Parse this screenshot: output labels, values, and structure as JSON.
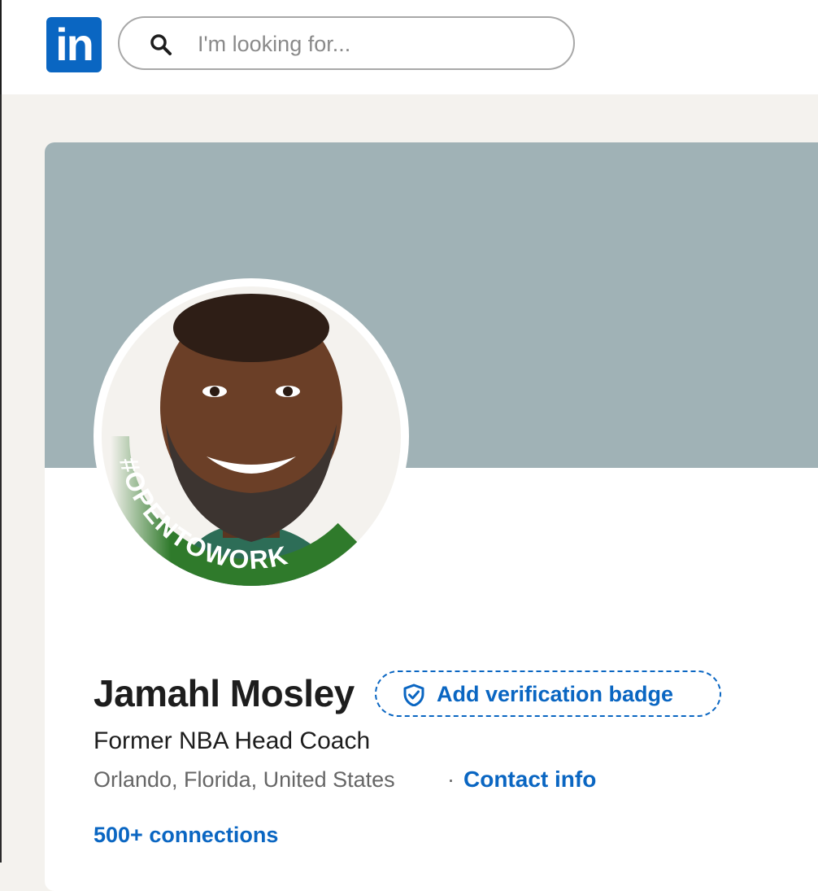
{
  "header": {
    "logo_text": "in",
    "search_placeholder": "I'm looking for..."
  },
  "profile": {
    "frame_text": "#OPENTOWORK",
    "name": "Jamahl Mosley",
    "verification_label": "Add verification badge",
    "headline": "Former NBA Head Coach",
    "location": "Orlando, Florida, United States",
    "separator": "·",
    "contact_label": "Contact info",
    "connections_label": "500+ connections"
  },
  "colors": {
    "brand": "#0a66c2",
    "cover": "#a0b2b6",
    "open_to_work": "#2f7a2b"
  },
  "icons": {
    "search": "search-icon",
    "verification": "shield-check-icon"
  }
}
